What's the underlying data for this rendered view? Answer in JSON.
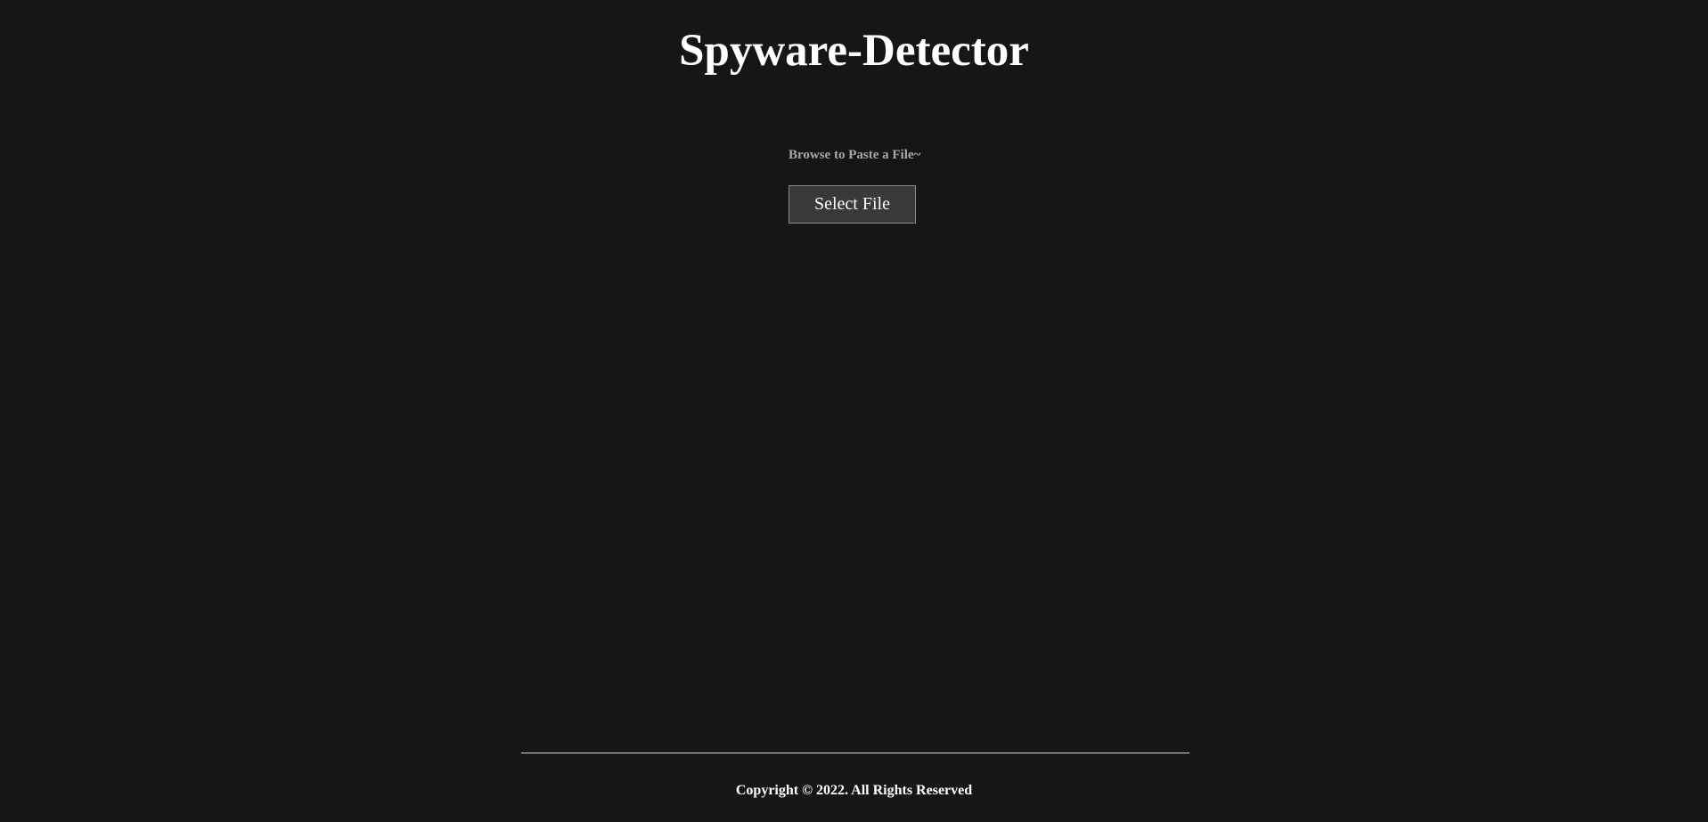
{
  "header": {
    "title": "Spyware-Detector"
  },
  "upload": {
    "label": "Browse to Paste a File~",
    "button_label": "Select File"
  },
  "footer": {
    "copyright": "Copyright © 2022. All Rights Reserved"
  },
  "colors": {
    "background": "#161615",
    "title_text": "#ffffff",
    "label_text": "#a8a8a8",
    "button_background": "#393939",
    "button_border": "#8a8a8a",
    "divider": "#d8d8d8"
  }
}
